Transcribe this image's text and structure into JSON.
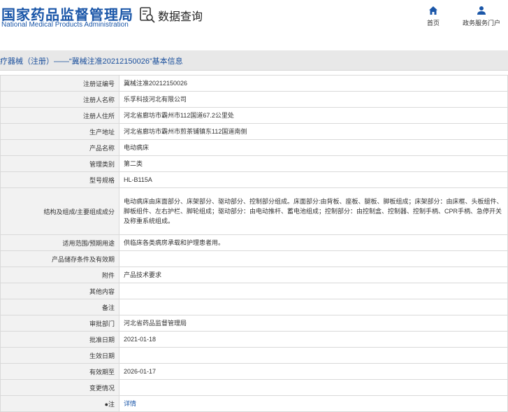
{
  "header": {
    "logo_cn": "国家药品监督管理局",
    "logo_en": "National Medical Products Administration",
    "search_title": "数据查询",
    "nav": [
      {
        "label": "首页",
        "icon": "home-icon"
      },
      {
        "label": "政务服务门户",
        "icon": "user-icon"
      }
    ]
  },
  "colors": {
    "brand": "#1a56a8",
    "label_bg": "#f2f2f2",
    "title_bg": "#e8e8e8"
  },
  "page_title": "疗器械（注册）——“冀械注准20212150026”基本信息",
  "rows": [
    {
      "label": "注册证编号",
      "value": "冀械注准20212150026"
    },
    {
      "label": "注册人名称",
      "value": "乐孚科技河北有限公司"
    },
    {
      "label": "注册人住所",
      "value": "河北省廊坊市霸州市112国道67.2公里处"
    },
    {
      "label": "生产地址",
      "value": "河北省廊坊市霸州市煎茶铺镇东112国道南侧"
    },
    {
      "label": "产品名称",
      "value": "电动病床"
    },
    {
      "label": "管理类别",
      "value": "第二类"
    },
    {
      "label": "型号规格",
      "value": "HL-B115A"
    },
    {
      "label": "结构及组成/主要组成成分",
      "value": "电动病床由床面部分、床架部分、驱动部分、控制部分组成。床面部分:由背板、座板、腿板、脚板组成；床架部分：由床框、头板组件、脚板组件、左右护栏、脚轮组成；驱动部分：由电动推杆、蓄电池组成；控制部分：由控制盒、控制器、控制手柄、CPR手柄、急停开关及称重系统组成。"
    },
    {
      "label": "适用范围/预期用途",
      "value": "供临床各类病房承载和护理患者用。"
    },
    {
      "label": "产品储存条件及有效期",
      "value": ""
    },
    {
      "label": "附件",
      "value": "产品技术要求"
    },
    {
      "label": "其他内容",
      "value": ""
    },
    {
      "label": "备注",
      "value": ""
    },
    {
      "label": "审批部门",
      "value": "河北省药品监督管理局"
    },
    {
      "label": "批准日期",
      "value": "2021-01-18"
    },
    {
      "label": "生效日期",
      "value": ""
    },
    {
      "label": "有效期至",
      "value": "2026-01-17"
    },
    {
      "label": "变更情况",
      "value": ""
    },
    {
      "label": "●注",
      "value": "详情",
      "link": true
    }
  ]
}
